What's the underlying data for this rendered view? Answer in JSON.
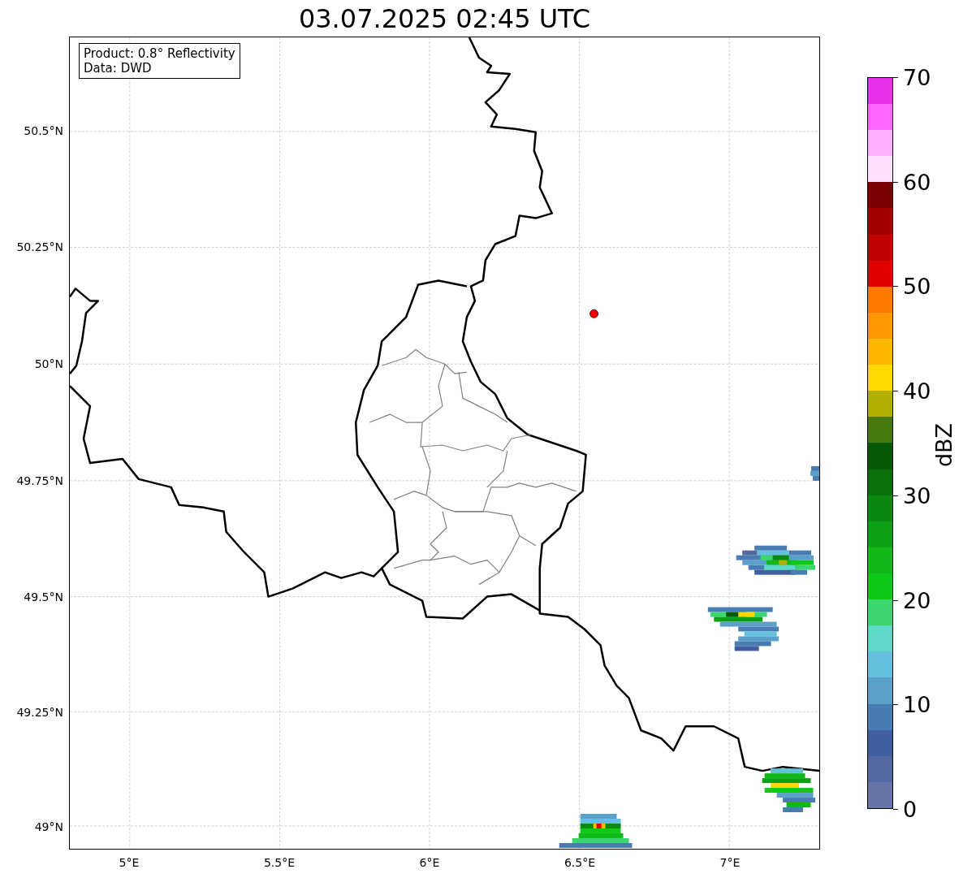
{
  "title": "03.07.2025 02:45 UTC",
  "info_box": [
    "Product: 0.8° Reflectivity",
    "Data: DWD"
  ],
  "x_axis": {
    "ticks": [
      "5°E",
      "5.5°E",
      "6°E",
      "6.5°E",
      "7°E"
    ]
  },
  "y_axis": {
    "ticks": [
      "50.5°N",
      "50.25°N",
      "50°N",
      "49.75°N",
      "49.5°N",
      "49.25°N",
      "49°N"
    ]
  },
  "colorbar": {
    "label": "dBZ",
    "ticks": [
      "70",
      "60",
      "50",
      "40",
      "30",
      "20",
      "10",
      "0"
    ],
    "bins": [
      {
        "color": "#6674a8"
      },
      {
        "color": "#5468a0"
      },
      {
        "color": "#405fa0"
      },
      {
        "color": "#4a7cb4"
      },
      {
        "color": "#5aa0c8"
      },
      {
        "color": "#64c0dc"
      },
      {
        "color": "#60d8c8"
      },
      {
        "color": "#3cd670"
      },
      {
        "color": "#10c818"
      },
      {
        "color": "#10b818"
      },
      {
        "color": "#0ea014"
      },
      {
        "color": "#0a8810"
      },
      {
        "color": "#0a700c"
      },
      {
        "color": "#085808"
      },
      {
        "color": "#487810"
      },
      {
        "color": "#b0b000"
      },
      {
        "color": "#ffd800"
      },
      {
        "color": "#ffb800"
      },
      {
        "color": "#ff9800"
      },
      {
        "color": "#ff7800"
      },
      {
        "color": "#e00000"
      },
      {
        "color": "#c00000"
      },
      {
        "color": "#a00000"
      },
      {
        "color": "#780000"
      },
      {
        "color": "#ffe0ff"
      },
      {
        "color": "#ffb0ff"
      },
      {
        "color": "#ff66ff"
      },
      {
        "color": "#e830e8"
      }
    ]
  }
}
